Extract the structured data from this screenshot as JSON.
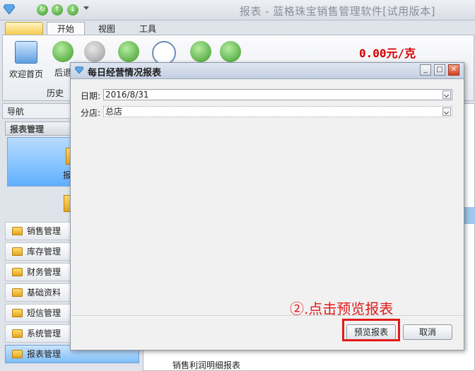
{
  "window": {
    "title": "报表 - 蓝格珠宝销售管理软件[试用版本]"
  },
  "ribbon_tabs": [
    {
      "label": "开始",
      "active": true
    },
    {
      "label": "视图",
      "active": false
    },
    {
      "label": "工具",
      "active": false
    }
  ],
  "ribbon": {
    "welcome_label": "欢迎首页",
    "back_label": "后退",
    "group_history": "历史",
    "price": "0.00元/克"
  },
  "nav": {
    "header": "导航",
    "group": "报表管理",
    "tile_label": "报表",
    "items": [
      {
        "label": "销售管理"
      },
      {
        "label": "库存管理"
      },
      {
        "label": "财务管理"
      },
      {
        "label": "基础资料"
      },
      {
        "label": "短信管理"
      },
      {
        "label": "系统管理"
      },
      {
        "label": "报表管理"
      }
    ]
  },
  "content": {
    "visible_row": "销售利润明细报表"
  },
  "dialog": {
    "title": "每日经营情况报表",
    "date_label": "日期:",
    "date_value": "2016/8/31",
    "branch_label": "分店:",
    "branch_value": "总店",
    "preview_button": "预览报表",
    "cancel_button": "取消"
  },
  "annotation": {
    "text": "②.点击预览报表",
    "color": "#e21a1a"
  },
  "colors": {
    "accent": "#5fb0ff",
    "price": "#d40000"
  }
}
